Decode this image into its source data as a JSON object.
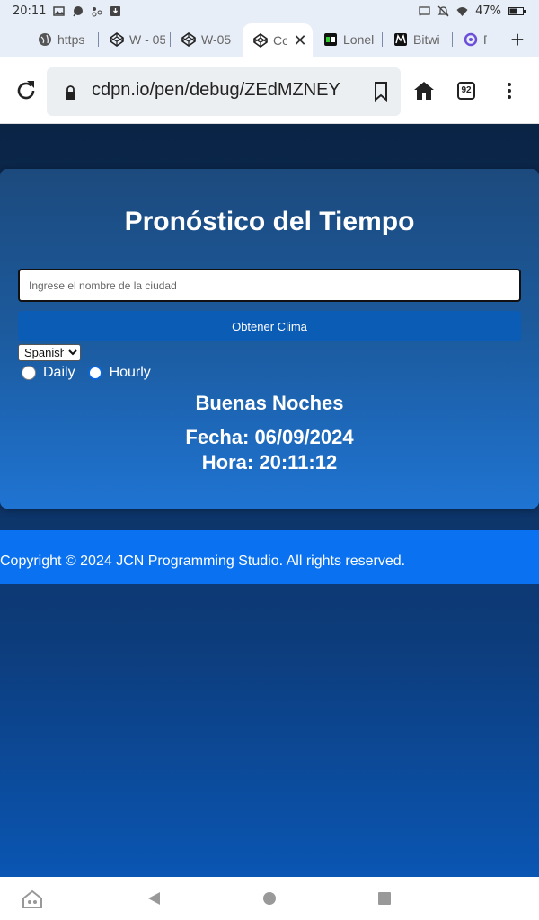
{
  "status_bar": {
    "time": "20:11",
    "battery": "47%"
  },
  "tabs": [
    {
      "title": "https",
      "icon": "globe-icon"
    },
    {
      "title": "W - 05",
      "icon": "codepen-icon"
    },
    {
      "title": "W-05",
      "icon": "codepen-icon"
    },
    {
      "title": "Co",
      "icon": "codepen-icon",
      "active": true
    },
    {
      "title": "Lonel",
      "icon": "app-icon"
    },
    {
      "title": "Bitwi",
      "icon": "m-logo-icon"
    },
    {
      "title": "P",
      "icon": "spiral-icon"
    }
  ],
  "address_bar": {
    "url": "cdpn.io/pen/debug/ZEdMZNEY",
    "tab_count": "92"
  },
  "app": {
    "title": "Pronóstico del Tiempo",
    "city_placeholder": "Ingrese el nombre de la ciudad",
    "city_value": "",
    "get_weather_button": "Obtener Clima",
    "language_selected": "Spanish",
    "forecast_options": [
      {
        "label": "Daily",
        "checked": false
      },
      {
        "label": "Hourly",
        "checked": true
      }
    ],
    "greeting": "Buenas Noches",
    "date_line": "Fecha: 06/09/2024",
    "time_line": "Hora: 20:11:12"
  },
  "footer": {
    "copyright": "Copyright © 2024 JCN Programming Studio. All rights reserved."
  },
  "colors": {
    "page_bg_top": "#0a2446",
    "page_bg_bottom": "#0a56b3",
    "card_bg": "#1c5b9f",
    "button_bg": "#0a5cb5",
    "footer_bg": "#0a72f0",
    "radio_accent": "#0a66d9"
  }
}
